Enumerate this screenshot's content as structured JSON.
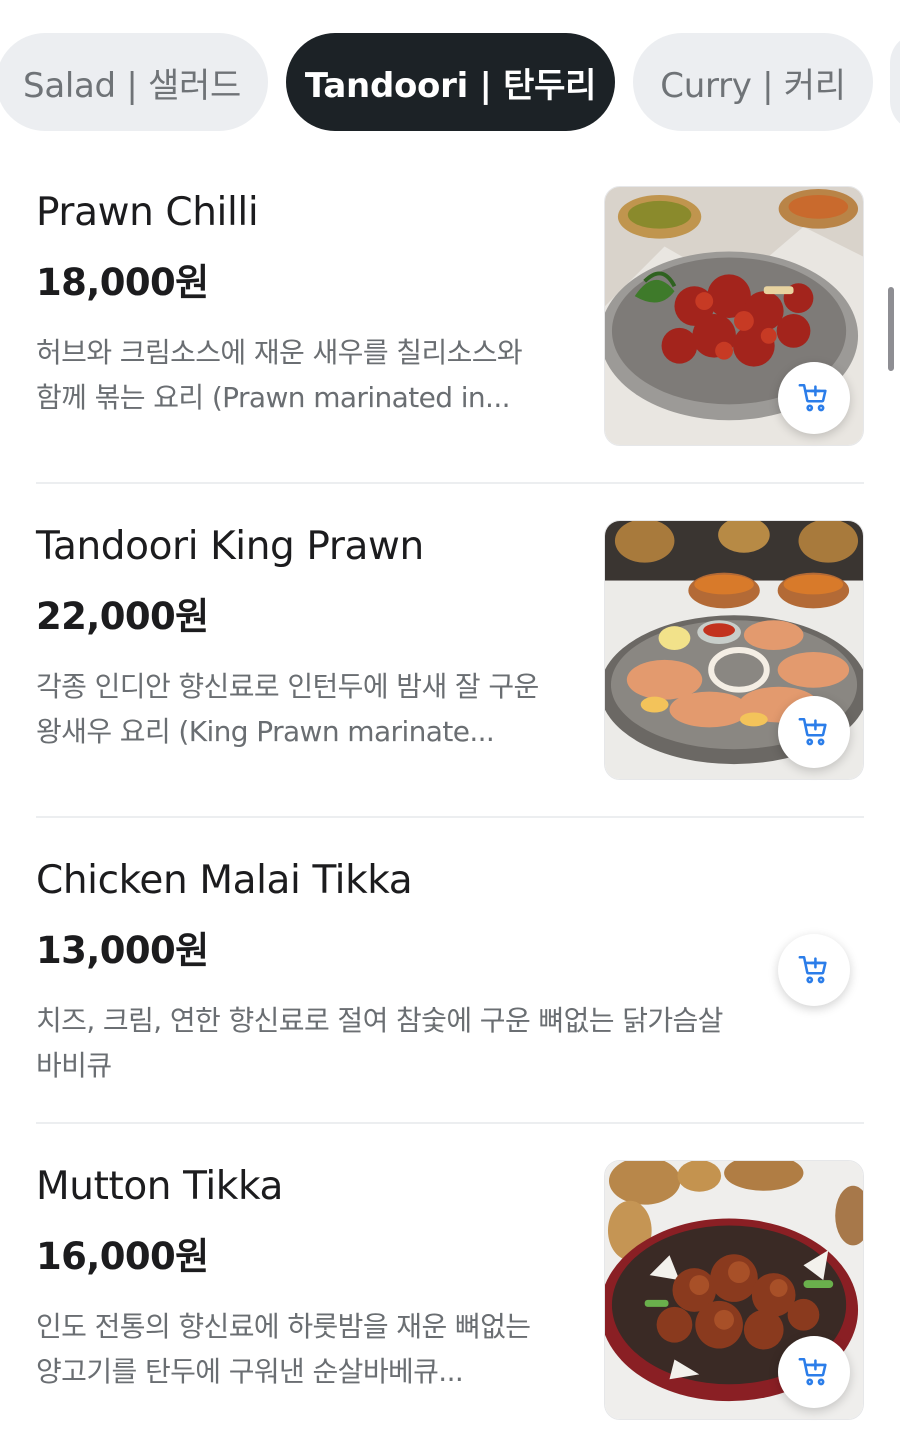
{
  "tabs": [
    {
      "label": "Salad | 샐러드",
      "active": false
    },
    {
      "label": "Tandoori | 탄두리",
      "active": true
    },
    {
      "label": "Curry | 커리",
      "active": false
    }
  ],
  "menu": {
    "items": [
      {
        "name": "Prawn Chilli",
        "price": "18,000원",
        "description": "허브와 크림소스에 재운 새우를 칠리소스와 함께 볶는 요리 (Prawn marinated in...",
        "has_image": true
      },
      {
        "name": "Tandoori King Prawn",
        "price": "22,000원",
        "description": "각종 인디안 향신료로 인턴두에 밤새 잘 구운 왕새우 요리 (King Prawn marinate...",
        "has_image": true
      },
      {
        "name": "Chicken Malai Tikka",
        "price": "13,000원",
        "description": "치즈, 크림, 연한 향신료로 절여 참숯에 구운 뼈없는 닭가슴살 바비큐",
        "has_image": false
      },
      {
        "name": "Mutton Tikka",
        "price": "16,000원",
        "description": "인도 전통의 향신료에 하룻밤을 재운 뼈없는 양고기를 탄두에 구워낸 순살바베큐...",
        "has_image": true
      }
    ]
  },
  "colors": {
    "accent": "#2b7de9",
    "tab_active_bg": "#1c2226",
    "tab_bg": "#eceef1"
  },
  "icons": {
    "cart": "add-to-cart-icon"
  }
}
